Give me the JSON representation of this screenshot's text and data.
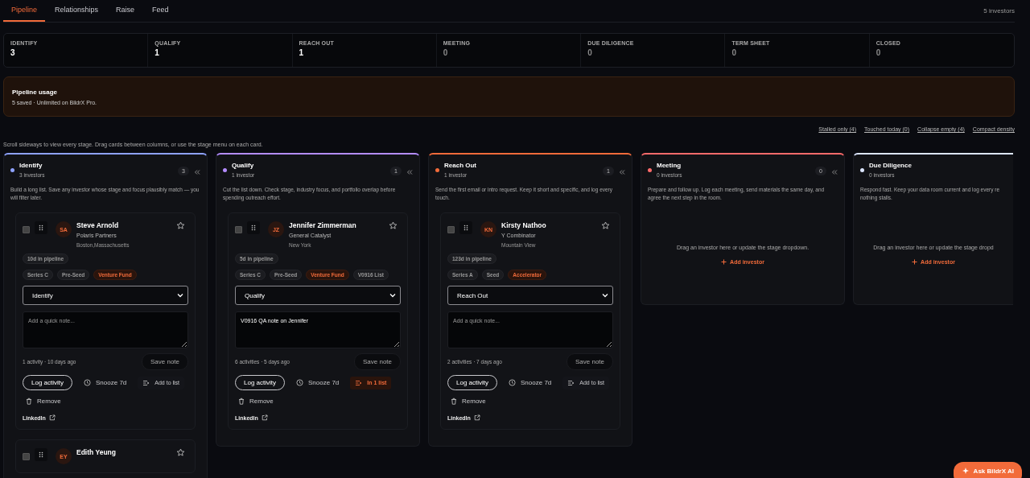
{
  "tabs": [
    {
      "label": "Pipeline",
      "selected": true
    },
    {
      "label": "Relationships",
      "selected": false
    },
    {
      "label": "Raise",
      "selected": false
    },
    {
      "label": "Feed",
      "selected": false
    }
  ],
  "investor_total": "5 investors",
  "stats": [
    {
      "label": "IDENTIFY",
      "value": "3",
      "active": true
    },
    {
      "label": "QUALIFY",
      "value": "1",
      "active": true
    },
    {
      "label": "REACH OUT",
      "value": "1",
      "active": true
    },
    {
      "label": "MEETING",
      "value": "0",
      "active": false
    },
    {
      "label": "DUE DILIGENCE",
      "value": "0",
      "active": false
    },
    {
      "label": "TERM SHEET",
      "value": "0",
      "active": false
    },
    {
      "label": "CLOSED",
      "value": "0",
      "active": false
    }
  ],
  "usage": {
    "title": "Pipeline usage",
    "text": "5 saved · Unlimited on BildrX Pro."
  },
  "filters": [
    "Stalled only (4)",
    "Touched today (0)",
    "Collapse empty (4)",
    "Compact density"
  ],
  "hint": "Scroll sideways to view every stage. Drag cards between columns, or use the stage menu on each card.",
  "columns": [
    {
      "title": "Identify",
      "subtitle": "3 investors",
      "badge": "3",
      "color": "#8ea2ff",
      "description": "Build a long list. Save any investor whose stage and focus plausibly match — you will filter later.",
      "cards": [
        {
          "initials": "SA",
          "name": "Steve Arnold",
          "firm": "Polaris Partners",
          "location": "Boston,Massachusetts",
          "checked": false,
          "starred": false,
          "age": "10d in pipeline",
          "tags": [
            {
              "label": "Series C",
              "kind": "stage"
            },
            {
              "label": "Pre-Seed",
              "kind": "stage"
            },
            {
              "label": "Venture Fund",
              "kind": "type"
            }
          ],
          "stage": "Identify",
          "note": {
            "placeholder": "Add a quick note..."
          },
          "meta": "1 activity · 10 days ago",
          "save": "Save note",
          "log": "Log activity",
          "snooze": "Snooze 7d",
          "list": {
            "label": "Add to list",
            "in_list": false
          },
          "remove": "Remove",
          "link": "LinkedIn"
        },
        {
          "initials": "EY",
          "name": "Edith Yeung",
          "checked": false,
          "starred": false
        }
      ]
    },
    {
      "title": "Qualify",
      "subtitle": "1 investor",
      "badge": "1",
      "color": "#b48cff",
      "description": "Cut the list down. Check stage, industry focus, and portfolio overlap before spending outreach effort.",
      "cards": [
        {
          "initials": "JZ",
          "name": "Jennifer Zimmerman",
          "firm": "General Catalyst",
          "location": "New York",
          "checked": false,
          "starred": false,
          "age": "5d in pipeline",
          "tags": [
            {
              "label": "Series C",
              "kind": "stage"
            },
            {
              "label": "Pre-Seed",
              "kind": "stage"
            },
            {
              "label": "Venture Fund",
              "kind": "type"
            },
            {
              "label": "V0916 List",
              "kind": "stage"
            }
          ],
          "stage": "Qualify",
          "note": {
            "value": "V0916 QA note on Jennifer"
          },
          "meta": "6 activities · 5 days ago",
          "save": "Save note",
          "log": "Log activity",
          "snooze": "Snooze 7d",
          "list": {
            "label": "In 1 list",
            "in_list": true
          },
          "remove": "Remove",
          "link": "LinkedIn"
        }
      ]
    },
    {
      "title": "Reach Out",
      "subtitle": "1 investor",
      "badge": "1",
      "color": "#f26b3a",
      "description": "Send the first email or intro request. Keep it short and specific, and log every touch.",
      "cards": [
        {
          "initials": "KN",
          "name": "Kirsty Nathoo",
          "firm": "Y Combinator",
          "location": "Mountain View",
          "checked": false,
          "starred": false,
          "age": "123d in pipeline",
          "tags": [
            {
              "label": "Series A",
              "kind": "stage"
            },
            {
              "label": "Seed",
              "kind": "stage"
            },
            {
              "label": "Accelerator",
              "kind": "type"
            }
          ],
          "stage": "Reach Out",
          "note": {
            "placeholder": "Add a quick note..."
          },
          "meta": "2 activities · 7 days ago",
          "save": "Save note",
          "log": "Log activity",
          "snooze": "Snooze 7d",
          "list": {
            "label": "Add to list",
            "in_list": false
          },
          "remove": "Remove",
          "link": "LinkedIn"
        }
      ]
    },
    {
      "title": "Meeting",
      "subtitle": "0 investors",
      "badge": "0",
      "color": "#ff6b6b",
      "description": "Prepare and follow up. Log each meeting, send materials the same day, and agree the next step in the room.",
      "empty": {
        "text": "Drag an investor here or update the stage dropdown.",
        "action": "Add investor"
      }
    },
    {
      "title": "Due Diligence",
      "subtitle": "0 investors",
      "color": "#dce6ff",
      "description": "Respond fast. Keep your data room current and log every re nothing stalls.",
      "empty": {
        "text": "Drag an investor here or update the stage dropd",
        "action": "Add investor"
      }
    }
  ],
  "assistant_button": "Ask BildrX AI"
}
